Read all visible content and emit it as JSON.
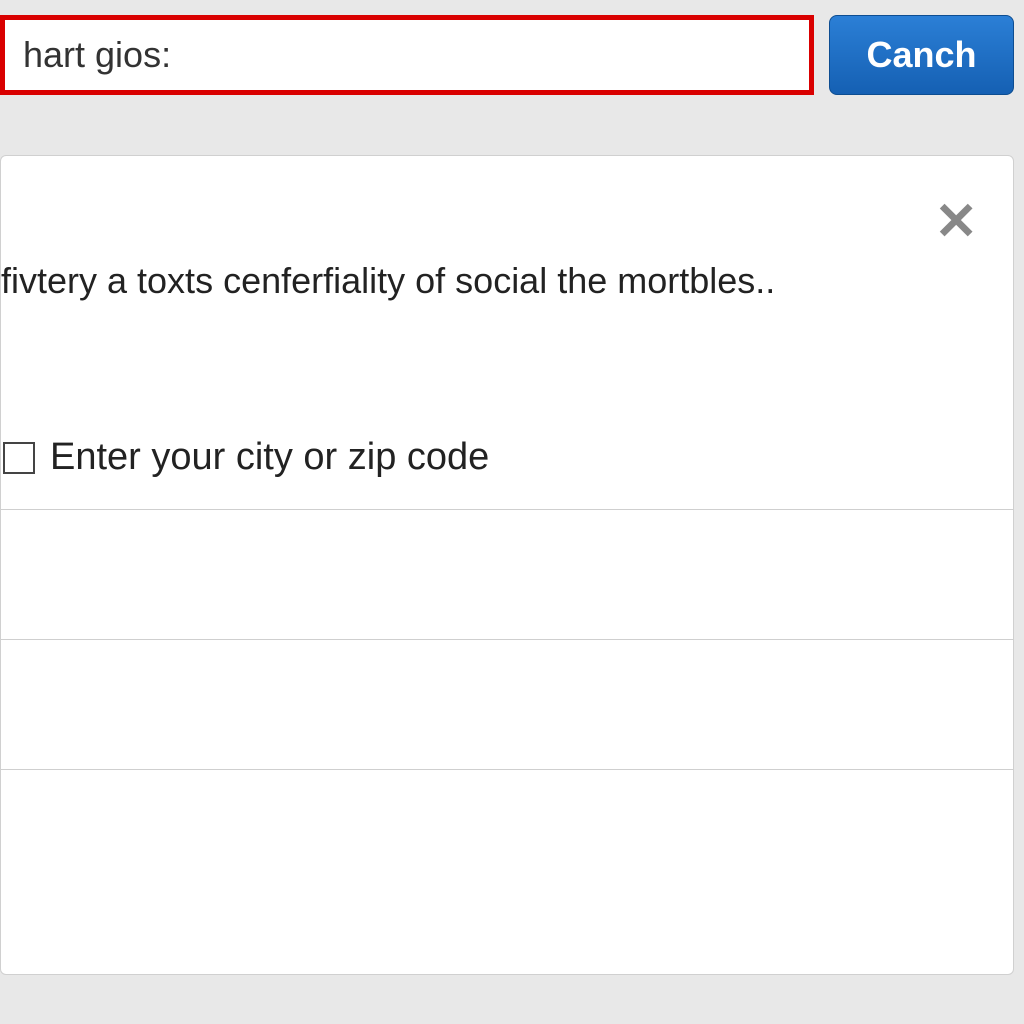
{
  "topbar": {
    "search_value": "hart gios:",
    "cancel_label": "Canch"
  },
  "panel": {
    "description": "fivtery a toxts cenferfiality of social the mortbles..",
    "location_label": "Enter your city or zip code"
  }
}
